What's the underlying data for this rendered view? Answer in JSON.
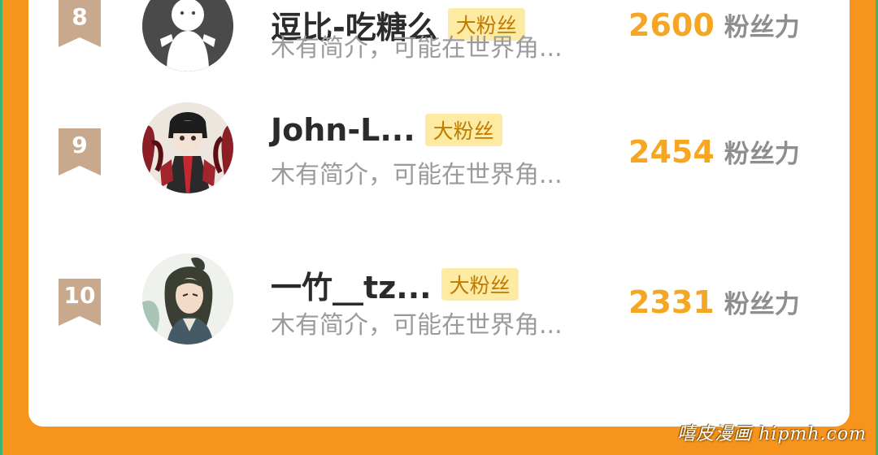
{
  "ranking": {
    "rows": [
      {
        "rank": "8",
        "name": "逗比-吃糖么",
        "badge": "大粉丝",
        "bio": "木有简介，可能在世界角...",
        "score": "2600",
        "score_unit": "粉丝力",
        "avatar": "default-avatar"
      },
      {
        "rank": "9",
        "name": "John-L...",
        "badge": "大粉丝",
        "bio": "木有简介，可能在世界角...",
        "score": "2454",
        "score_unit": "粉丝力",
        "avatar": "anime-avatar"
      },
      {
        "rank": "10",
        "name": "一竹__tz...",
        "badge": "大粉丝",
        "bio": "木有简介，可能在世界角...",
        "score": "2331",
        "score_unit": "粉丝力",
        "avatar": "anime-avatar"
      }
    ]
  },
  "watermark": "嘻皮漫画 hipmh.com",
  "colors": {
    "background": "#f7941d",
    "card": "#ffffff",
    "rank_badge": "#c9a98e",
    "score": "#f5a623",
    "fan_badge_bg": "#fdeba3"
  }
}
